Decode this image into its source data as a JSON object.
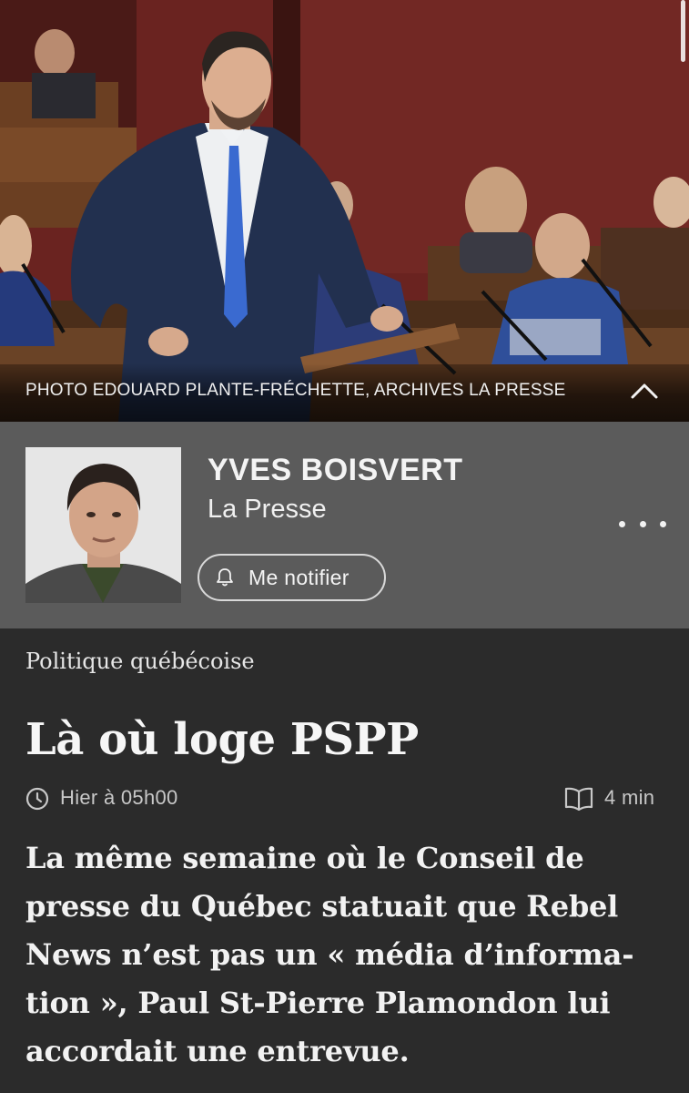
{
  "photo": {
    "credit": "PHOTO EDOUARD PLANTE-FRÉCHETTE, ARCHIVES LA PRESSE",
    "collapse_icon": "chevron-up-icon"
  },
  "author": {
    "name": "YVES BOISVERT",
    "outlet": "La Presse",
    "notify_label": "Me notifier",
    "notify_icon": "bell-icon",
    "more_icon": "more-horizontal-icon"
  },
  "article": {
    "section": "Politique québécoise",
    "title": "Là où loge PSPP",
    "published": "Hier à 05h00",
    "reading_time": "4 min",
    "lede_lines": [
      "La même semaine où le Conseil de",
      "presse du Québec statuait que Rebel",
      "News n’est pas un « média d’informa-",
      "tion », Paul St-Pierre Plamondon lui",
      "accordait une entrevue."
    ]
  },
  "colors": {
    "page_bg": "#2b2b2b",
    "author_bg": "#5b5b5b",
    "text": "#f2f2f2",
    "muted": "#c8c8c8"
  }
}
